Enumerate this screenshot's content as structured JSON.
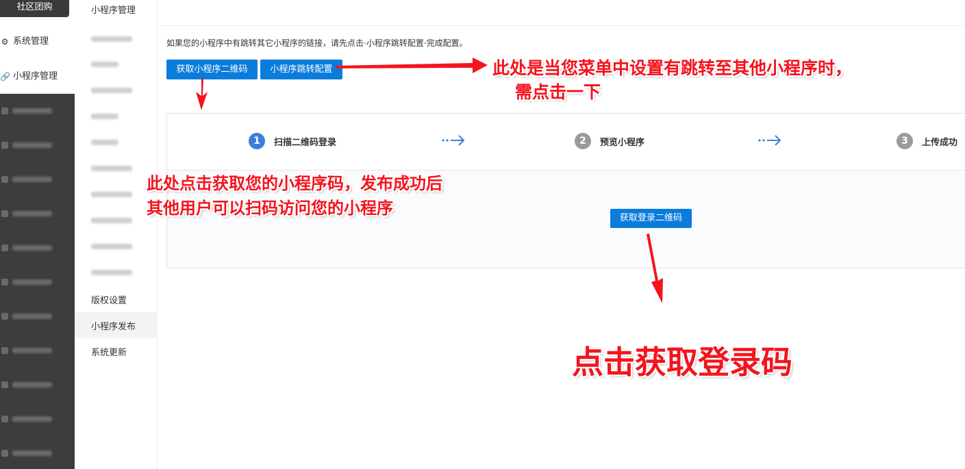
{
  "nav": {
    "brand": "社区团购",
    "items": [
      {
        "label": "系统管理",
        "icon": "gear-icon"
      },
      {
        "label": "小程序管理",
        "icon": "link-icon"
      }
    ]
  },
  "submenu": {
    "title": "小程序管理",
    "items": [
      "版权设置",
      "小程序发布",
      "系统更新"
    ]
  },
  "main": {
    "notice": "如果您的小程序中有跳转其它小程序的链接，请先点击·小程序跳转配置·完成配置。",
    "btn_qrcode": "获取小程序二维码",
    "btn_jump": "小程序跳转配置",
    "steps": [
      {
        "num": "1",
        "label": "扫描二维码登录"
      },
      {
        "num": "2",
        "label": "预览小程序"
      },
      {
        "num": "3",
        "label": "上传成功"
      }
    ],
    "btn_login": "获取登录二维码"
  },
  "annotations": {
    "jump_line1": "此处是当您菜单中设置有跳转至其他小程序时，",
    "jump_line2": "需点击一下",
    "qr_line1": "此处点击获取您的小程序码，发布成功后",
    "qr_line2": "其他用户可以扫码访问您的小程序",
    "login": "点击获取登录码"
  },
  "colors": {
    "primary_button": "#0a7cdc",
    "annotation_red": "#f4141e",
    "nav_dark": "#3d3d3d"
  }
}
